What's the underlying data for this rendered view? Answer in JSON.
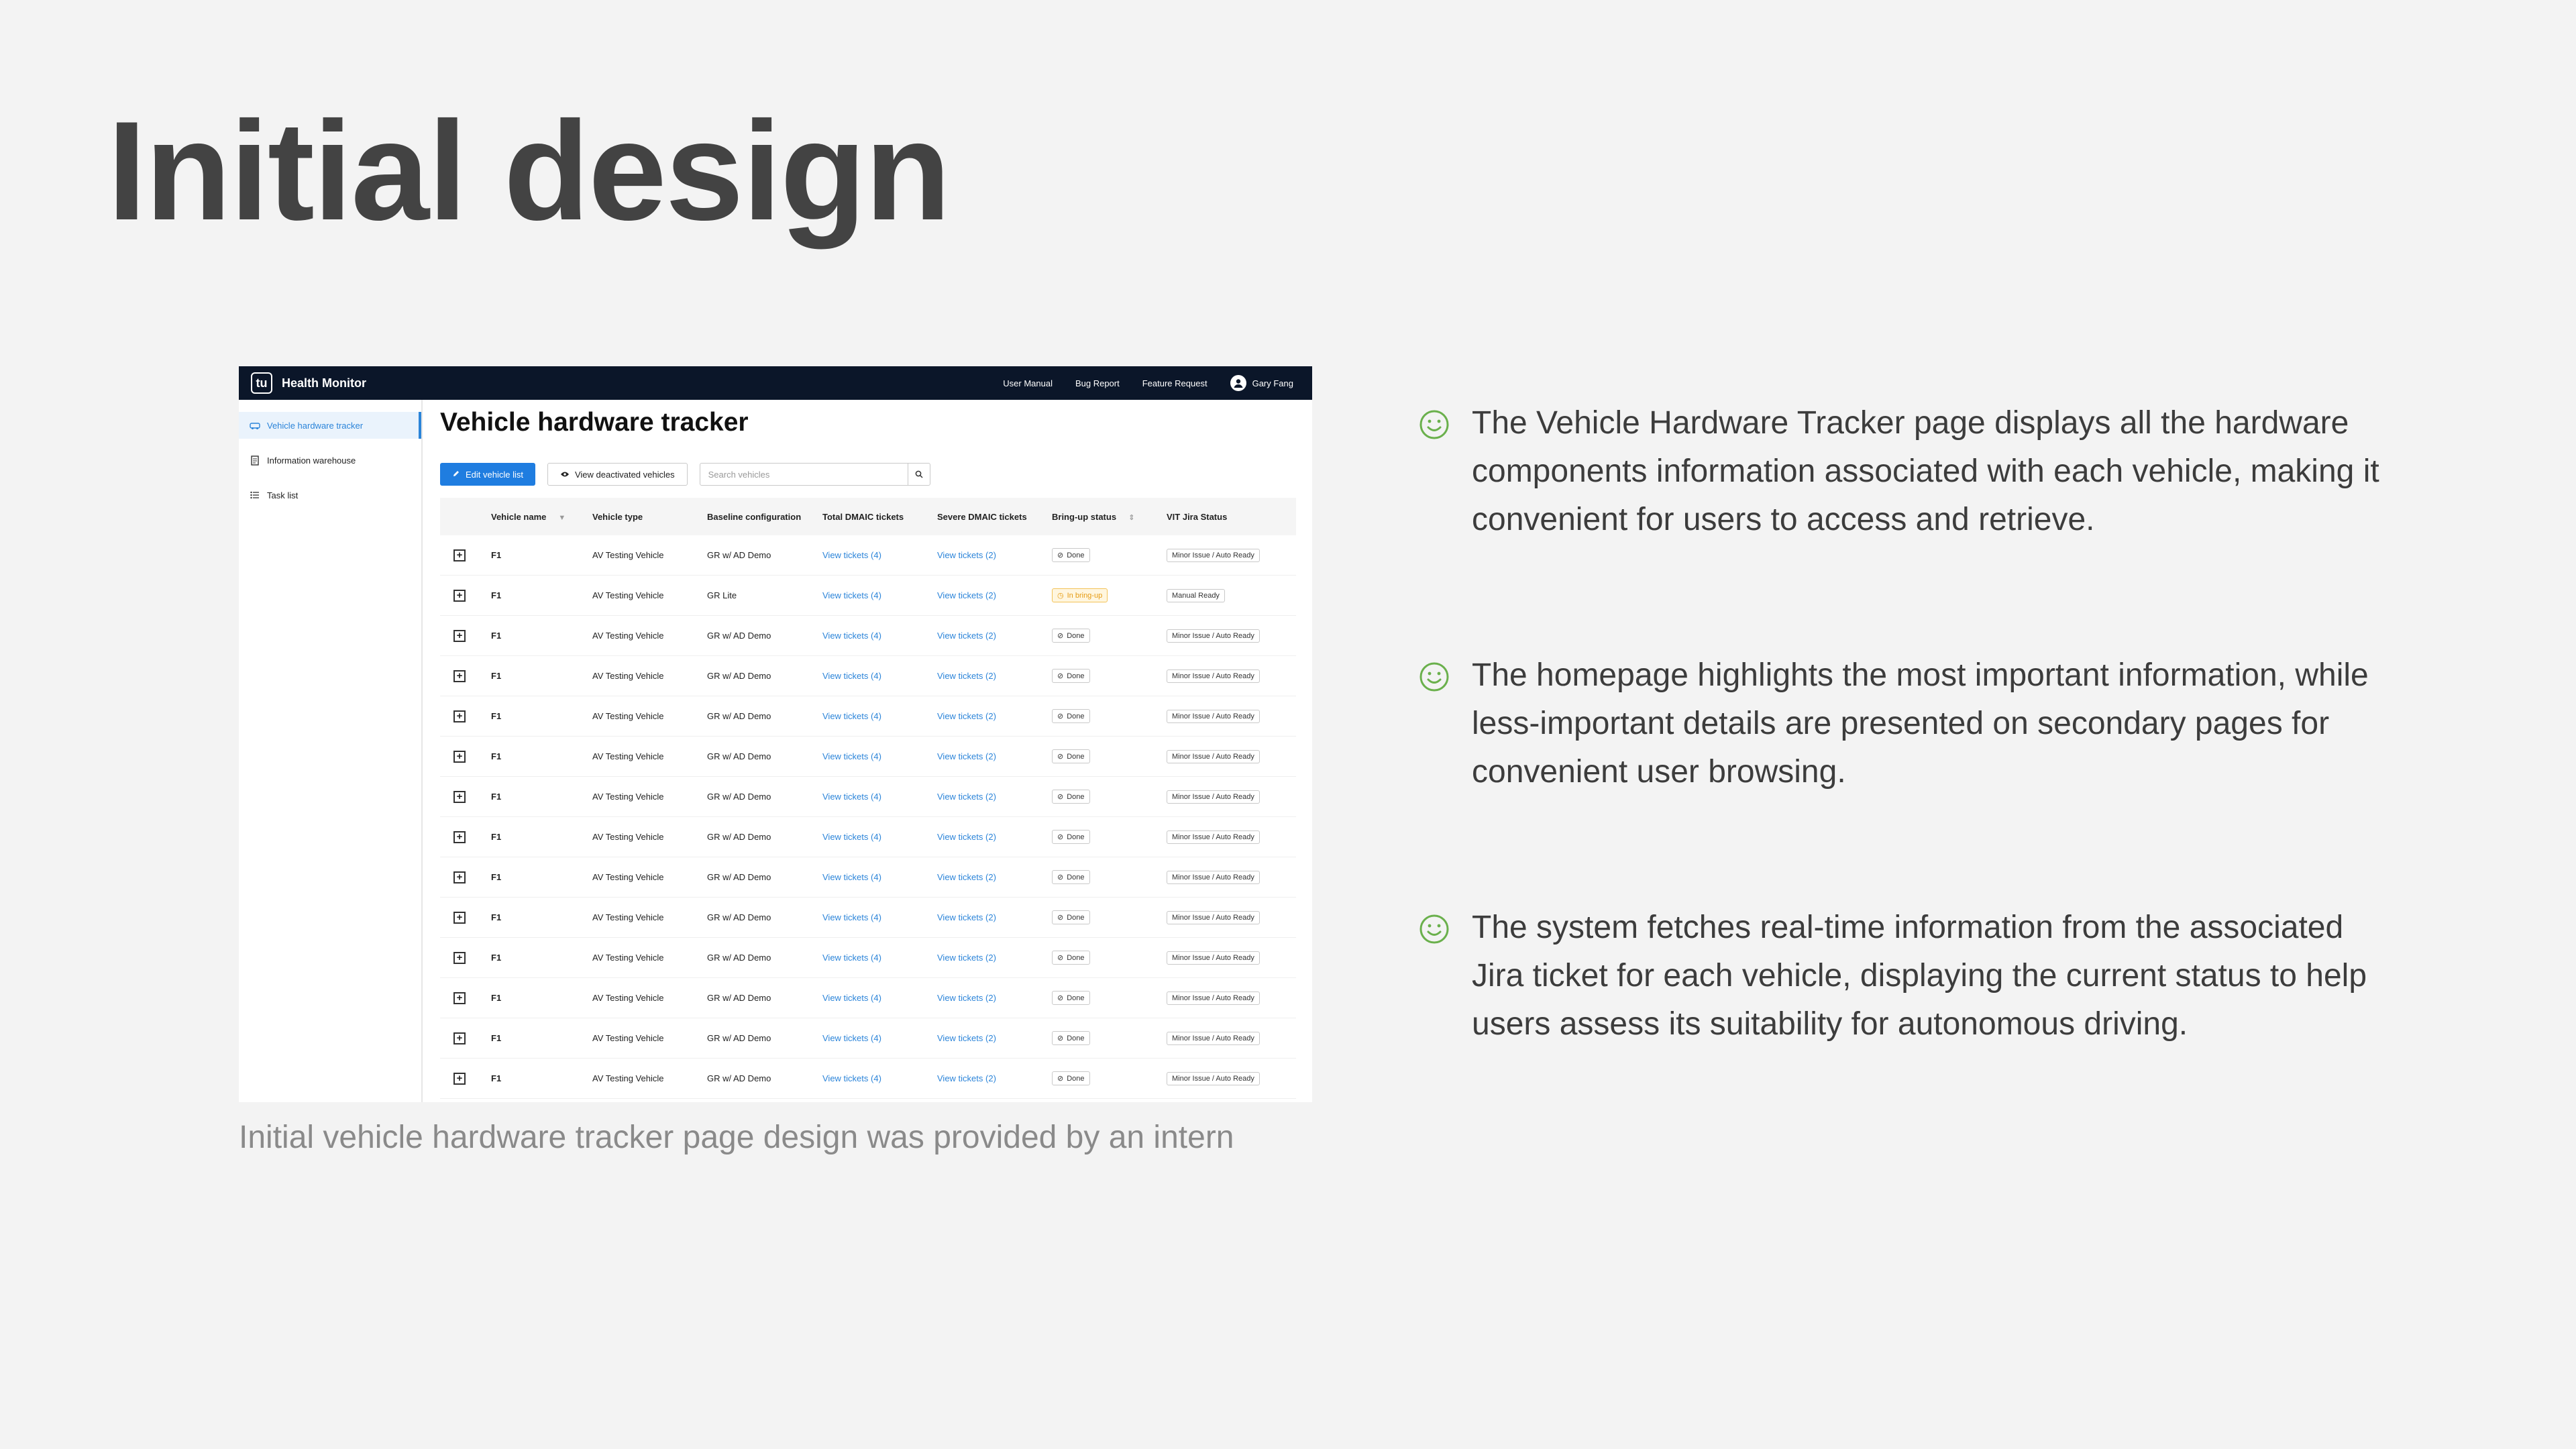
{
  "slide": {
    "title": "Initial design",
    "caption": "Initial vehicle hardware tracker page design was provided by an intern",
    "accent_color": "#6ab04c",
    "bullets": [
      {
        "icon": "smile-icon",
        "text": "The Vehicle Hardware Tracker page displays all the hardware components information associated with each vehicle, making it convenient for users to access and retrieve."
      },
      {
        "icon": "smile-icon",
        "text": "The homepage highlights the most important information, while less-important details are presented on secondary pages for convenient user browsing."
      },
      {
        "icon": "smile-icon",
        "text": "The system fetches real-time information from the associated Jira ticket for each vehicle, displaying the current status to help users assess its suitability for autonomous driving."
      }
    ]
  },
  "mockup": {
    "topbar": {
      "logo": "tu",
      "app_name": "Health Monitor",
      "links": [
        "User Manual",
        "Bug Report",
        "Feature Request"
      ],
      "user_name": "Gary Fang"
    },
    "sidebar": {
      "items": [
        {
          "label": "Vehicle hardware tracker",
          "icon": "car-icon",
          "active": true
        },
        {
          "label": "Information warehouse",
          "icon": "document-icon",
          "active": false
        },
        {
          "label": "Task list",
          "icon": "list-icon",
          "active": false
        }
      ]
    },
    "page_title": "Vehicle hardware tracker",
    "toolbar": {
      "edit_label": "Edit vehicle list",
      "view_deactivated_label": "View deactivated vehicles",
      "search_placeholder": "Search vehicles"
    },
    "table": {
      "columns": [
        "Vehicle name",
        "Vehicle type",
        "Baseline configuration",
        "Total DMAIC tickets",
        "Severe DMAIC tickets",
        "Bring-up status",
        "VIT Jira Status"
      ],
      "rows": [
        {
          "name": "F1",
          "type": "AV Testing Vehicle",
          "baseline": "GR w/ AD Demo",
          "total": "View tickets (4)",
          "severe": "View tickets (2)",
          "bringup": "Done",
          "bringup_state": "done",
          "jira": "Minor Issue / Auto Ready"
        },
        {
          "name": "F1",
          "type": "AV Testing Vehicle",
          "baseline": "GR Lite",
          "total": "View tickets (4)",
          "severe": "View tickets (2)",
          "bringup": "In bring-up",
          "bringup_state": "warn",
          "jira": "Manual Ready"
        },
        {
          "name": "F1",
          "type": "AV Testing Vehicle",
          "baseline": "GR w/ AD Demo",
          "total": "View tickets (4)",
          "severe": "View tickets (2)",
          "bringup": "Done",
          "bringup_state": "done",
          "jira": "Minor Issue / Auto Ready"
        },
        {
          "name": "F1",
          "type": "AV Testing Vehicle",
          "baseline": "GR w/ AD Demo",
          "total": "View tickets (4)",
          "severe": "View tickets (2)",
          "bringup": "Done",
          "bringup_state": "done",
          "jira": "Minor Issue / Auto Ready"
        },
        {
          "name": "F1",
          "type": "AV Testing Vehicle",
          "baseline": "GR w/ AD Demo",
          "total": "View tickets (4)",
          "severe": "View tickets (2)",
          "bringup": "Done",
          "bringup_state": "done",
          "jira": "Minor Issue / Auto Ready"
        },
        {
          "name": "F1",
          "type": "AV Testing Vehicle",
          "baseline": "GR w/ AD Demo",
          "total": "View tickets (4)",
          "severe": "View tickets (2)",
          "bringup": "Done",
          "bringup_state": "done",
          "jira": "Minor Issue / Auto Ready"
        },
        {
          "name": "F1",
          "type": "AV Testing Vehicle",
          "baseline": "GR w/ AD Demo",
          "total": "View tickets (4)",
          "severe": "View tickets (2)",
          "bringup": "Done",
          "bringup_state": "done",
          "jira": "Minor Issue / Auto Ready"
        },
        {
          "name": "F1",
          "type": "AV Testing Vehicle",
          "baseline": "GR w/ AD Demo",
          "total": "View tickets (4)",
          "severe": "View tickets (2)",
          "bringup": "Done",
          "bringup_state": "done",
          "jira": "Minor Issue / Auto Ready"
        },
        {
          "name": "F1",
          "type": "AV Testing Vehicle",
          "baseline": "GR w/ AD Demo",
          "total": "View tickets (4)",
          "severe": "View tickets (2)",
          "bringup": "Done",
          "bringup_state": "done",
          "jira": "Minor Issue / Auto Ready"
        },
        {
          "name": "F1",
          "type": "AV Testing Vehicle",
          "baseline": "GR w/ AD Demo",
          "total": "View tickets (4)",
          "severe": "View tickets (2)",
          "bringup": "Done",
          "bringup_state": "done",
          "jira": "Minor Issue / Auto Ready"
        },
        {
          "name": "F1",
          "type": "AV Testing Vehicle",
          "baseline": "GR w/ AD Demo",
          "total": "View tickets (4)",
          "severe": "View tickets (2)",
          "bringup": "Done",
          "bringup_state": "done",
          "jira": "Minor Issue / Auto Ready"
        },
        {
          "name": "F1",
          "type": "AV Testing Vehicle",
          "baseline": "GR w/ AD Demo",
          "total": "View tickets (4)",
          "severe": "View tickets (2)",
          "bringup": "Done",
          "bringup_state": "done",
          "jira": "Minor Issue / Auto Ready"
        },
        {
          "name": "F1",
          "type": "AV Testing Vehicle",
          "baseline": "GR w/ AD Demo",
          "total": "View tickets (4)",
          "severe": "View tickets (2)",
          "bringup": "Done",
          "bringup_state": "done",
          "jira": "Minor Issue / Auto Ready"
        },
        {
          "name": "F1",
          "type": "AV Testing Vehicle",
          "baseline": "GR w/ AD Demo",
          "total": "View tickets (4)",
          "severe": "View tickets (2)",
          "bringup": "Done",
          "bringup_state": "done",
          "jira": "Minor Issue / Auto Ready"
        }
      ]
    }
  }
}
